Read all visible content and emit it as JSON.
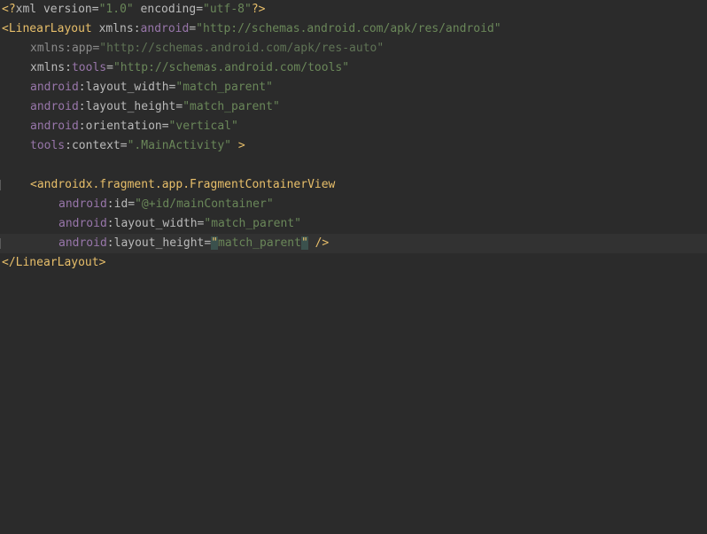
{
  "editor": {
    "lines": [
      {
        "decl_open": "<?",
        "decl_name": "xml",
        "v_attr": " version",
        "v_eq": "=",
        "v_val": "\"1.0\"",
        "e_attr": " encoding",
        "e_eq": "=",
        "e_val": "\"utf-8\"",
        "decl_close": "?>"
      },
      {
        "open": "<",
        "tag": "LinearLayout",
        "sp": " ",
        "attr_pre": "xmlns:",
        "attr_ns": "android",
        "eq": "=",
        "val": "\"http://schemas.android.com/apk/res/android\""
      },
      {
        "attr_pre": "xmlns:",
        "attr_name": "app",
        "eq": "=",
        "val": "\"http://schemas.android.com/apk/res-auto\""
      },
      {
        "attr_pre": "xmlns:",
        "attr_ns": "tools",
        "eq": "=",
        "val": "\"http://schemas.android.com/tools\""
      },
      {
        "ns": "android",
        "colon": ":",
        "attr": "layout_width",
        "eq": "=",
        "val": "\"match_parent\""
      },
      {
        "ns": "android",
        "colon": ":",
        "attr": "layout_height",
        "eq": "=",
        "val": "\"match_parent\""
      },
      {
        "ns": "android",
        "colon": ":",
        "attr": "orientation",
        "eq": "=",
        "val": "\"vertical\""
      },
      {
        "ns": "tools",
        "colon": ":",
        "attr": "context",
        "eq": "=",
        "val": "\".MainActivity\"",
        "close": " >"
      },
      {},
      {
        "open": "<",
        "tag": "androidx.fragment.app.FragmentContainerView"
      },
      {
        "ns": "android",
        "colon": ":",
        "attr": "id",
        "eq": "=",
        "val": "\"@+id/mainContainer\""
      },
      {
        "ns": "android",
        "colon": ":",
        "attr": "layout_width",
        "eq": "=",
        "val": "\"match_parent\""
      },
      {
        "ns": "android",
        "colon": ":",
        "attr": "layout_height",
        "eq": "=",
        "q1": "\"",
        "val": "match_parent",
        "q2": "\"",
        "close": " />"
      },
      {
        "open": "</",
        "tag": "LinearLayout",
        "close": ">"
      }
    ]
  }
}
